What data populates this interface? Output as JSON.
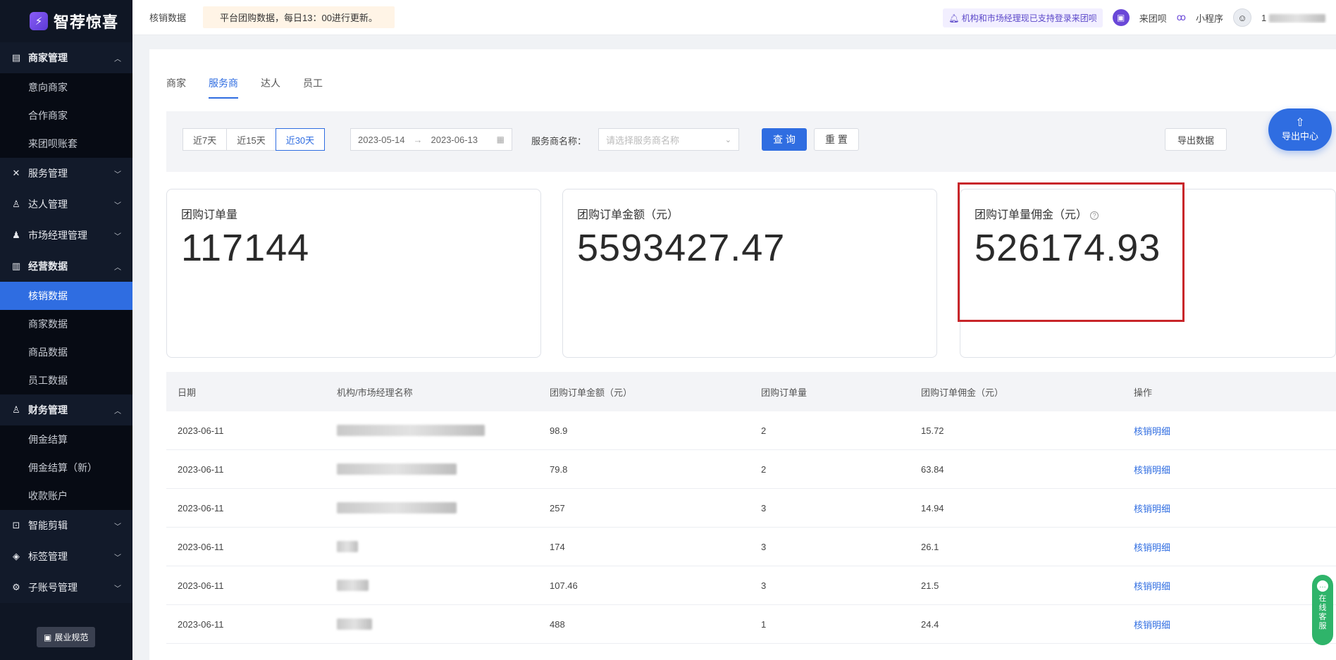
{
  "app": {
    "logo_text": "智荐惊喜",
    "logo_glyph": "⚡"
  },
  "sidebar": {
    "groups": [
      {
        "label": "商家管理",
        "icon": "store-icon",
        "expanded": true,
        "items": [
          "意向商家",
          "合作商家",
          "来团呗账套"
        ]
      },
      {
        "label": "服务管理",
        "icon": "service-icon",
        "expanded": false
      },
      {
        "label": "达人管理",
        "icon": "user-icon",
        "expanded": false
      },
      {
        "label": "市场经理管理",
        "icon": "manager-icon",
        "expanded": false
      },
      {
        "label": "经营数据",
        "icon": "chart-icon",
        "expanded": true,
        "items": [
          "核销数据",
          "商家数据",
          "商品数据",
          "员工数据"
        ],
        "active_item": "核销数据"
      },
      {
        "label": "财务管理",
        "icon": "finance-icon",
        "expanded": true,
        "items": [
          "佣金结算",
          "佣金结算（新）",
          "收款账户"
        ]
      },
      {
        "label": "智能剪辑",
        "icon": "edit-icon",
        "expanded": false
      },
      {
        "label": "标签管理",
        "icon": "tag-icon",
        "expanded": false
      },
      {
        "label": "子账号管理",
        "icon": "gear-icon",
        "expanded": false
      }
    ],
    "rule_button": "展业规范"
  },
  "topbar": {
    "title": "核销数据",
    "notice": "平台团购数据，每日13：00进行更新。",
    "tip": "机构和市场经理现已支持登录来团呗",
    "laituanbei": "来团呗",
    "miniprogram": "小程序",
    "user_prefix": "1"
  },
  "tabs": [
    "商家",
    "服务商",
    "达人",
    "员工"
  ],
  "active_tab": "服务商",
  "filter": {
    "ranges": [
      "近7天",
      "近15天",
      "近30天"
    ],
    "active_range": "近30天",
    "date_start": "2023-05-14",
    "date_end": "2023-06-13",
    "provider_label": "服务商名称：",
    "provider_placeholder": "请选择服务商名称",
    "query_btn": "查 询",
    "reset_btn": "重 置",
    "export_btn": "导出数据"
  },
  "export_center": "导出中心",
  "stats": [
    {
      "label": "团购订单量",
      "value": "117144"
    },
    {
      "label": "团购订单金额（元）",
      "value": "5593427.47"
    },
    {
      "label": "团购订单量佣金（元）",
      "value": "526174.93"
    }
  ],
  "table": {
    "headers": [
      "日期",
      "机构/市场经理名称",
      "团购订单金额（元）",
      "团购订单量",
      "团购订单佣金（元）",
      "操作"
    ],
    "rows": [
      {
        "date": "2023-06-11",
        "amount": "98.9",
        "count": "2",
        "commission": "15.72",
        "action": "核销明细"
      },
      {
        "date": "2023-06-11",
        "amount": "79.8",
        "count": "2",
        "commission": "63.84",
        "action": "核销明细"
      },
      {
        "date": "2023-06-11",
        "amount": "257",
        "count": "3",
        "commission": "14.94",
        "action": "核销明细"
      },
      {
        "date": "2023-06-11",
        "amount": "174",
        "count": "3",
        "commission": "26.1",
        "action": "核销明细"
      },
      {
        "date": "2023-06-11",
        "amount": "107.46",
        "count": "3",
        "commission": "21.5",
        "action": "核销明细"
      },
      {
        "date": "2023-06-11",
        "amount": "488",
        "count": "1",
        "commission": "24.4",
        "action": "核销明细"
      }
    ]
  },
  "chat_widget": "在线客服",
  "colors": {
    "primary": "#2f6de1",
    "sidebar_bg": "#0f1624",
    "highlight_border": "#c8262a"
  }
}
